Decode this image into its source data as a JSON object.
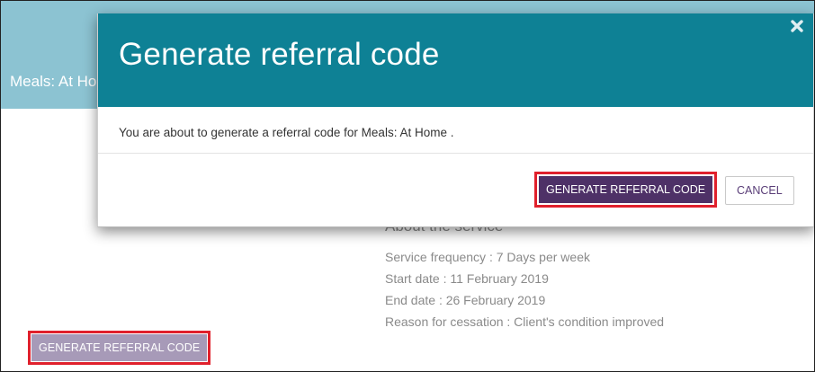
{
  "page": {
    "header_title": "Meals: At Home",
    "details": {
      "section_title": "About the service",
      "lines": [
        "Service frequency : 7 Days per week",
        "Start date : 11 February 2019",
        "End date : 26 February 2019",
        "Reason for cessation : Client's condition improved"
      ]
    },
    "generate_button_label": "GENERATE REFERRAL CODE"
  },
  "modal": {
    "title": "Generate referral code",
    "message": "You are about to generate a referral code for Meals: At Home .",
    "confirm_label": "GENERATE REFERRAL CODE",
    "cancel_label": "CANCEL",
    "close_icon": "close-icon"
  },
  "colors": {
    "page_header": "#8cc3d2",
    "modal_header": "#0e8195",
    "confirm_button": "#4e3167",
    "disabled_button": "#a79ab8",
    "highlight_outline": "#e0202c"
  }
}
